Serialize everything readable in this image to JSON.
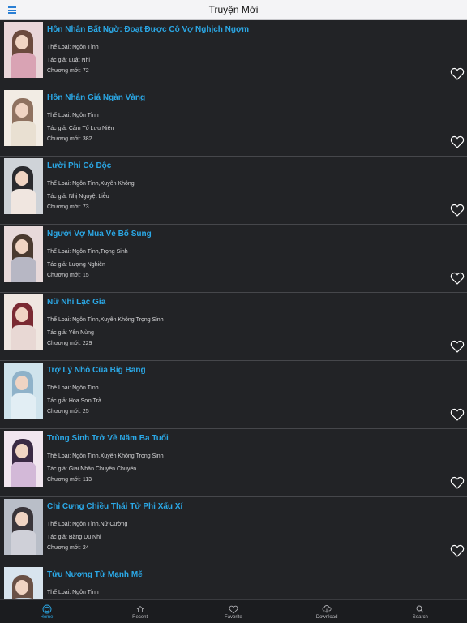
{
  "app": {
    "title": "Truyện Mới"
  },
  "stories": [
    {
      "title": "Hôn Nhân Bất Ngờ: Đoạt Được Cô Vợ Nghịch Ngợm",
      "genre": "Thể Loại: Ngôn Tình",
      "author": "Tác giả: Luật Nhi",
      "chapter": "Chương mới: 72"
    },
    {
      "title": "Hôn Nhân Giá Ngàn Vàng",
      "genre": "Thể Loại: Ngôn Tình",
      "author": "Tác giả: Cẩm Tố Lưu Niên",
      "chapter": "Chương mới: 382"
    },
    {
      "title": "Lười Phi Có Độc",
      "genre": "Thể Loại: Ngôn Tình,Xuyên Không",
      "author": "Tác giả: Nhị Nguyệt Liễu",
      "chapter": "Chương mới: 73"
    },
    {
      "title": "Người Vợ Mua Vé Bổ Sung",
      "genre": "Thể Loại: Ngôn Tình,Trọng Sinh",
      "author": "Tác giả: Lượng Nghiên",
      "chapter": "Chương mới: 15"
    },
    {
      "title": "Nữ Nhi Lạc Gia",
      "genre": "Thể Loại: Ngôn Tình,Xuyên Không,Trọng Sinh",
      "author": "Tác giả: Yên Nùng",
      "chapter": "Chương mới: 229"
    },
    {
      "title": "Trợ Lý Nhỏ Của Big Bang",
      "genre": "Thể Loại: Ngôn Tình",
      "author": "Tác giả: Hoa Sơn Trà",
      "chapter": "Chương mới: 25"
    },
    {
      "title": "Trùng Sinh Trở Về Năm Ba Tuổi",
      "genre": "Thể Loại: Ngôn Tình,Xuyên Không,Trọng Sinh",
      "author": "Tác giả: Giai Nhân Chuyển Chuyển",
      "chapter": "Chương mới: 113"
    },
    {
      "title": "Chỉ Cưng Chiều Thái Tử Phi Xấu Xí",
      "genre": "Thể Loại: Ngôn Tình,Nữ Cường",
      "author": "Tác giả: Băng Du Nhi",
      "chapter": "Chương mới: 24"
    },
    {
      "title": "Tửu Nương Tử Mạnh Mẽ",
      "genre": "Thể Loại: Ngôn Tình",
      "author": "",
      "chapter": ""
    }
  ],
  "tabs": [
    {
      "label": "Home",
      "icon": "home-icon",
      "active": true
    },
    {
      "label": "Recent",
      "icon": "recent-icon",
      "active": false
    },
    {
      "label": "Favorite",
      "icon": "heart-icon",
      "active": false
    },
    {
      "label": "Download",
      "icon": "cloud-download-icon",
      "active": false
    },
    {
      "label": "Search",
      "icon": "search-icon",
      "active": false
    }
  ],
  "colors": {
    "accent": "#2ba8e6",
    "background": "#222326",
    "topbar": "#f4f4f6"
  }
}
